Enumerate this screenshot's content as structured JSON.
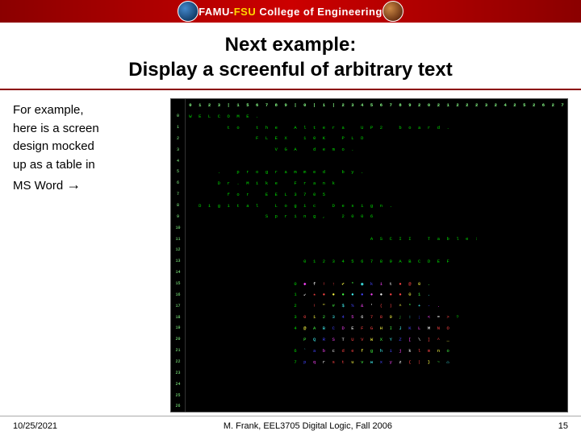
{
  "header": {
    "title_part1": "FAMU-",
    "title_part2": "FSU",
    "title_part3": " College of Engineering"
  },
  "title": {
    "line1": "Next example:",
    "line2": "Display a screenful of arbitrary text"
  },
  "left_text": {
    "paragraph": "For example, here is a screen design mocked up as a table in MS Word →"
  },
  "footer": {
    "date": "10/25/2021",
    "center": "M. Frank, EEL3705 Digital Logic, Fall 2006",
    "page": "15"
  }
}
